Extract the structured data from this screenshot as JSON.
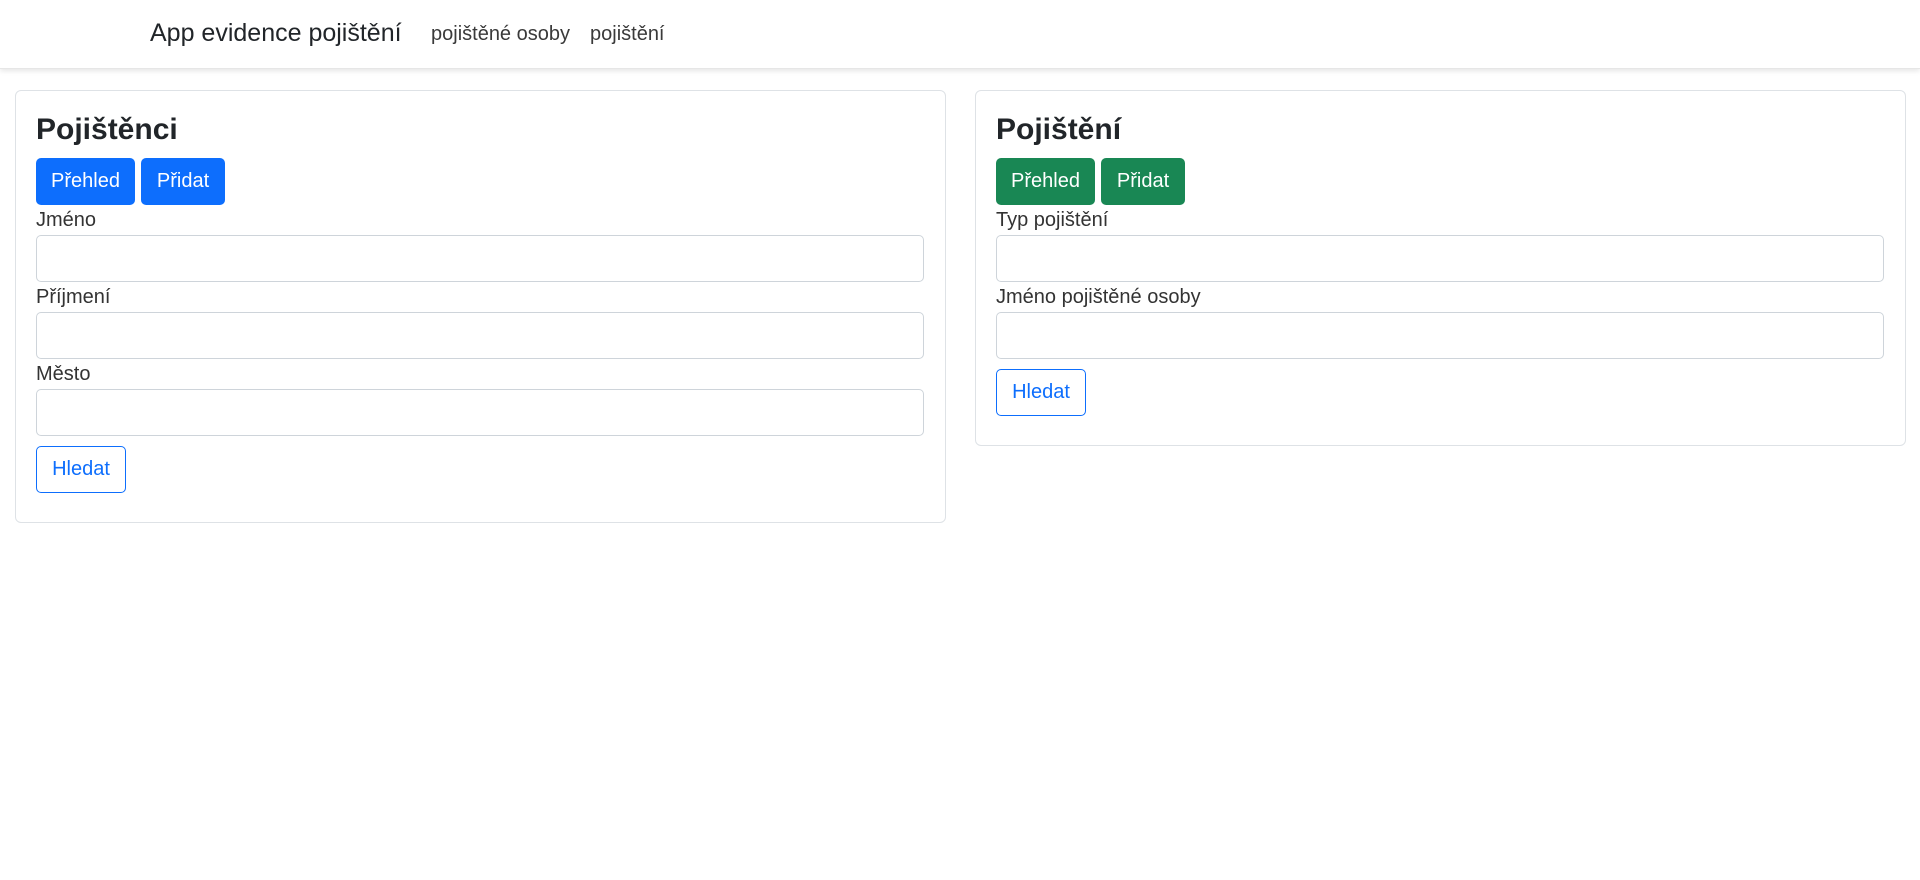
{
  "navbar": {
    "brand": "App evidence pojištění",
    "links": [
      "pojištěné osoby",
      "pojištění"
    ]
  },
  "insured_card": {
    "title": "Pojištěnci",
    "overview_button": "Přehled",
    "add_button": "Přidat",
    "fields": [
      {
        "label": "Jméno",
        "value": ""
      },
      {
        "label": "Příjmení",
        "value": ""
      },
      {
        "label": "Město",
        "value": ""
      }
    ],
    "search_button": "Hledat"
  },
  "insurance_card": {
    "title": "Pojištění",
    "overview_button": "Přehled",
    "add_button": "Přidat",
    "fields": [
      {
        "label": "Typ pojištění",
        "value": ""
      },
      {
        "label": "Jméno pojištěné osoby",
        "value": ""
      }
    ],
    "search_button": "Hledat"
  },
  "colors": {
    "primary": "#0d6efd",
    "success": "#198754",
    "border": "#dee2e6"
  }
}
